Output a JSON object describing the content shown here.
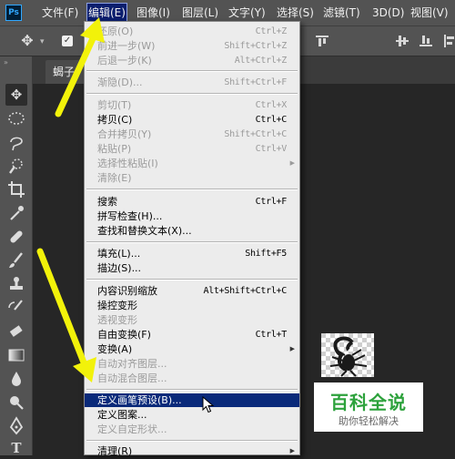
{
  "app": {
    "logo_text": "Ps"
  },
  "menubar": {
    "items": [
      "文件(F)",
      "编辑(E)",
      "图像(I)",
      "图层(L)",
      "文字(Y)",
      "选择(S)",
      "滤镜(T)",
      "3D(D)",
      "视图(V)"
    ]
  },
  "document": {
    "tab_label": "蝎子."
  },
  "edit_menu": {
    "items": [
      {
        "label": "还原(O)",
        "shortcut": "Ctrl+Z",
        "enabled": false
      },
      {
        "label": "前进一步(W)",
        "shortcut": "Shift+Ctrl+Z",
        "enabled": false
      },
      {
        "label": "后退一步(K)",
        "shortcut": "Alt+Ctrl+Z",
        "enabled": false
      },
      {
        "label": "渐隐(D)...",
        "shortcut": "Shift+Ctrl+F",
        "enabled": false
      },
      {
        "label": "剪切(T)",
        "shortcut": "Ctrl+X",
        "enabled": false
      },
      {
        "label": "拷贝(C)",
        "shortcut": "Ctrl+C",
        "enabled": true
      },
      {
        "label": "合并拷贝(Y)",
        "shortcut": "Shift+Ctrl+C",
        "enabled": false
      },
      {
        "label": "粘贴(P)",
        "shortcut": "Ctrl+V",
        "enabled": false
      },
      {
        "label": "选择性粘贴(I)",
        "shortcut": "",
        "enabled": false,
        "submenu": true
      },
      {
        "label": "清除(E)",
        "shortcut": "",
        "enabled": false
      },
      {
        "label": "搜索",
        "shortcut": "Ctrl+F",
        "enabled": true
      },
      {
        "label": "拼写检查(H)...",
        "shortcut": "",
        "enabled": true
      },
      {
        "label": "查找和替换文本(X)...",
        "shortcut": "",
        "enabled": true
      },
      {
        "label": "填充(L)...",
        "shortcut": "Shift+F5",
        "enabled": true
      },
      {
        "label": "描边(S)...",
        "shortcut": "",
        "enabled": true
      },
      {
        "label": "内容识别缩放",
        "shortcut": "Alt+Shift+Ctrl+C",
        "enabled": true
      },
      {
        "label": "操控变形",
        "shortcut": "",
        "enabled": true
      },
      {
        "label": "透视变形",
        "shortcut": "",
        "enabled": false
      },
      {
        "label": "自由变换(F)",
        "shortcut": "Ctrl+T",
        "enabled": true
      },
      {
        "label": "变换(A)",
        "shortcut": "",
        "enabled": true,
        "submenu": true
      },
      {
        "label": "自动对齐图层...",
        "shortcut": "",
        "enabled": false
      },
      {
        "label": "自动混合图层...",
        "shortcut": "",
        "enabled": false
      },
      {
        "label": "定义画笔预设(B)...",
        "shortcut": "",
        "enabled": true,
        "highlighted": true
      },
      {
        "label": "定义图案...",
        "shortcut": "",
        "enabled": true
      },
      {
        "label": "定义自定形状...",
        "shortcut": "",
        "enabled": false
      },
      {
        "label": "清理(R)",
        "shortcut": "",
        "enabled": true,
        "submenu": true
      }
    ]
  },
  "watermark": {
    "title": "百科全说",
    "subtitle": "助你轻松解决"
  },
  "colors": {
    "highlight": "#0a2a7a",
    "arrow": "#f2f20a",
    "watermark_green": "#2da23c"
  }
}
